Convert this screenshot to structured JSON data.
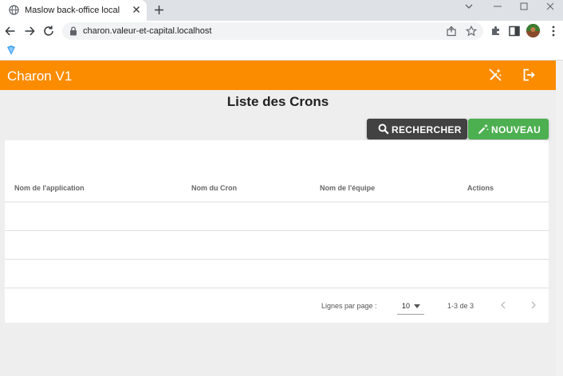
{
  "browser": {
    "tab_title": "Maslow back-office local",
    "url": "charon.valeur-et-capital.localhost"
  },
  "app": {
    "title": "Charon V1",
    "page_title": "Liste des Crons",
    "accent_color": "#fb8c00",
    "buttons": {
      "search": {
        "label": "RECHERCHER",
        "icon": "search-icon",
        "color": "#424242"
      },
      "new": {
        "label": "NOUVEAU",
        "icon": "magic-wand-icon",
        "color": "#4caf50"
      }
    },
    "table": {
      "headers": [
        "Nom de l'application",
        "Nom du Cron",
        "Nom de l'équipe",
        "Actions"
      ],
      "rows": [
        [
          "",
          "",
          "",
          ""
        ],
        [
          "",
          "",
          "",
          ""
        ],
        [
          "",
          "",
          "",
          ""
        ]
      ]
    },
    "pagination": {
      "rows_per_page_label": "Lignes par page :",
      "rows_per_page_value": "10",
      "range_text": "1-3 de 3"
    }
  }
}
